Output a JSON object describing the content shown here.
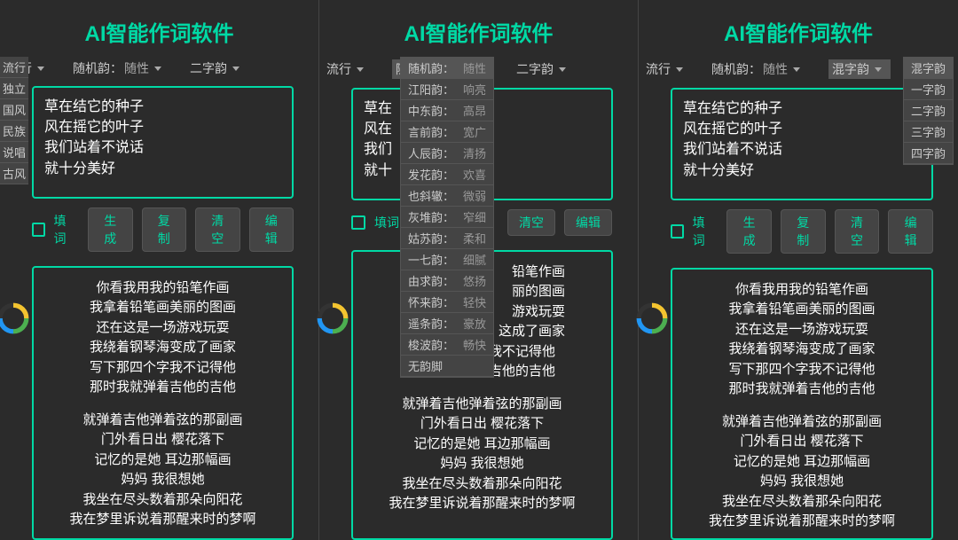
{
  "app_title": "AI智能作词软件",
  "styles": [
    "流行",
    "独立",
    "国风",
    "民族",
    "说唱",
    "古风"
  ],
  "toolbar": {
    "style_value": "流行",
    "rhyme_label_prefix": "随机韵：",
    "rhyme_value": "随性",
    "yun_value": "二字韵",
    "yun_value_panel3": "混字韵"
  },
  "input_lines": [
    "草在结它的种子",
    "风在摇它的叶子",
    "我们站着不说话",
    "就十分美好"
  ],
  "input_partial": [
    "草在",
    "风在",
    "我们",
    "就十"
  ],
  "actions": {
    "fill_label": "填词",
    "generate": "生成",
    "copy": "复制",
    "clear": "清空",
    "edit": "编辑"
  },
  "output": {
    "stanza1": [
      "你看我用我的铅笔作画",
      "我拿着铅笔画美丽的图画",
      "还在这是一场游戏玩耍",
      "我绕着钢琴海变成了画家",
      "写下那四个字我不记得他",
      "那时我就弹着吉他的吉他"
    ],
    "stanza2": [
      "就弹着吉他弹着弦的那副画",
      "门外看日出 樱花落下",
      "记忆的是她 耳边那幅画",
      "妈妈 我很想她",
      "我坐在尽头数着那朵向阳花",
      "我在梦里诉说着那醒来时的梦啊"
    ]
  },
  "output_partial_lines": [
    "铅笔作画",
    "丽的图画",
    "游戏玩耍",
    "这成了画家"
  ],
  "rhyme_options": [
    {
      "k": "随机韵：",
      "v": "随性"
    },
    {
      "k": "江阳韵：",
      "v": "响亮"
    },
    {
      "k": "中东韵：",
      "v": "高昂"
    },
    {
      "k": "言前韵：",
      "v": "宽广"
    },
    {
      "k": "人辰韵：",
      "v": "清扬"
    },
    {
      "k": "发花韵：",
      "v": "欢喜"
    },
    {
      "k": "也斜辙：",
      "v": "微弱"
    },
    {
      "k": "灰堆韵：",
      "v": "窄细"
    },
    {
      "k": "姑苏韵：",
      "v": "柔和"
    },
    {
      "k": "一七韵：",
      "v": "细腻"
    },
    {
      "k": "由求韵：",
      "v": "悠扬"
    },
    {
      "k": "怀来韵：",
      "v": "轻快"
    },
    {
      "k": "遥条韵：",
      "v": "豪放"
    },
    {
      "k": "梭波韵：",
      "v": "畅快"
    },
    {
      "k": "无韵脚",
      "v": ""
    }
  ],
  "yun_options": [
    "混字韵",
    "一字韵",
    "二字韵",
    "三字韵",
    "四字韵"
  ]
}
